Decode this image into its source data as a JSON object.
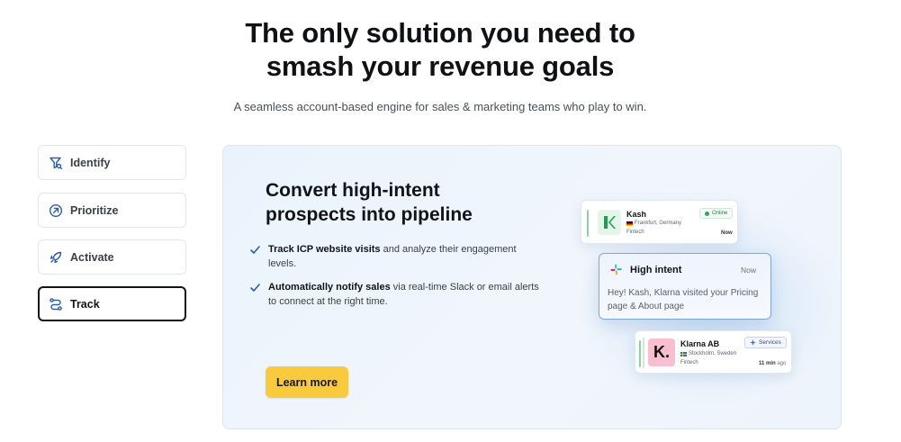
{
  "hero": {
    "title_line1": "The only solution you need to",
    "title_line2": "smash your revenue goals",
    "subtitle": "A seamless account-based engine for sales & marketing teams who play to win."
  },
  "tabs": [
    {
      "label": "Identify",
      "icon": "filter-icon",
      "active": false
    },
    {
      "label": "Prioritize",
      "icon": "arrow-circle-icon",
      "active": false
    },
    {
      "label": "Activate",
      "icon": "rocket-icon",
      "active": false
    },
    {
      "label": "Track",
      "icon": "route-icon",
      "active": true
    }
  ],
  "panel": {
    "heading_line1": "Convert high-intent",
    "heading_line2": "prospects into pipeline",
    "features": [
      {
        "bold": "Track ICP website visits",
        "text": " and analyze their engagement levels."
      },
      {
        "bold": "Automatically notify sales",
        "text": " via real-time Slack or email alerts to connect at the right time."
      }
    ],
    "cta_label": "Learn more"
  },
  "cards": {
    "kash": {
      "name": "Kash",
      "location": "Frankfurt, Germany",
      "industry": "Fintech",
      "status": "Online",
      "time": "Now"
    },
    "intent": {
      "title": "High intent",
      "time": "Now",
      "message": "Hey! Kash, Klarna visited your Pricing page & About page"
    },
    "klarna": {
      "name": "Klarna AB",
      "location": "Stockholm, Sweden",
      "industry": "Fintech",
      "badge": "Services",
      "time_bold": "11 min",
      "time_rest": " ago",
      "logo_letter": "K."
    }
  },
  "colors": {
    "accent_button": "#f9c93e",
    "panel_bg": "#eaf3fc",
    "online_green": "#2fa85a",
    "klarna_pink": "#f9bfd0"
  }
}
